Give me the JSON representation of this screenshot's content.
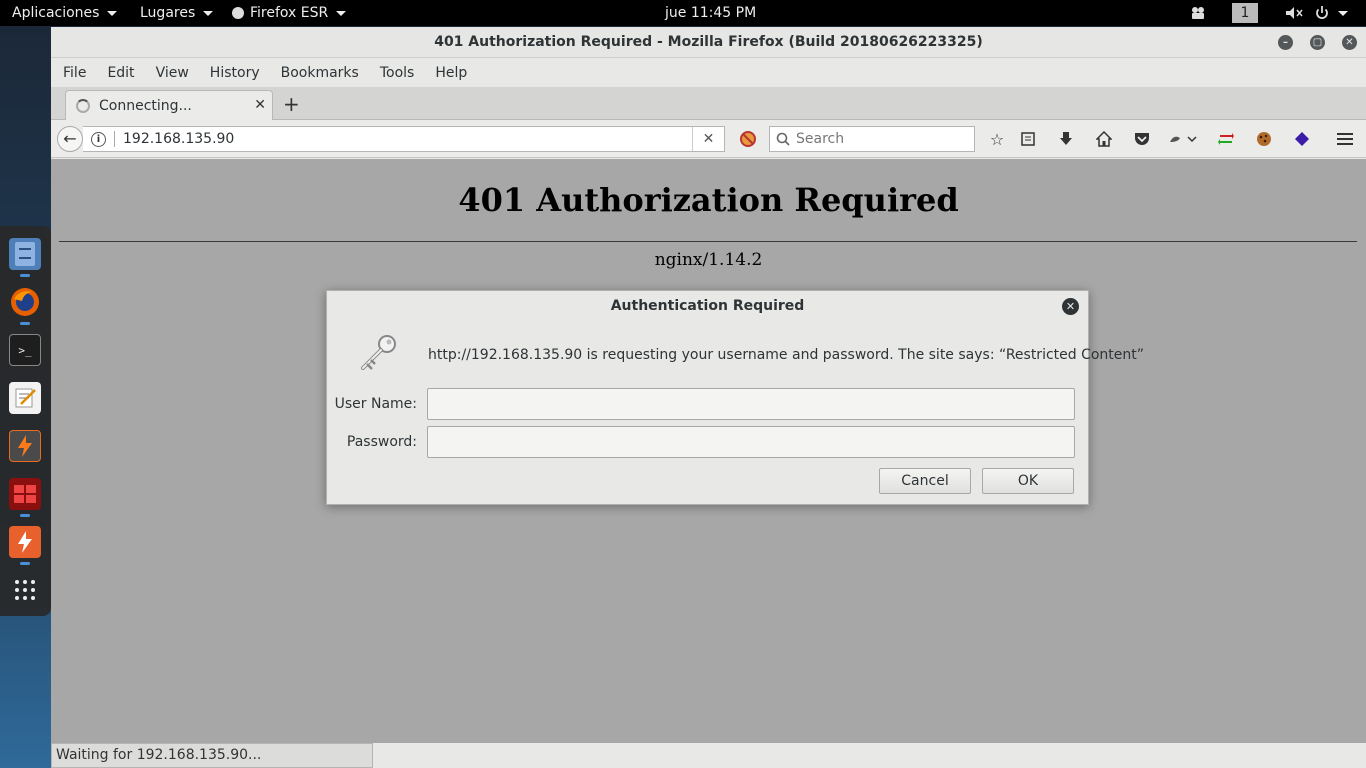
{
  "topbar": {
    "applications": "Aplicaciones",
    "places": "Lugares",
    "active_app": "Firefox ESR",
    "clock": "jue 11:45 PM",
    "workspace": "1"
  },
  "window": {
    "title": "401 Authorization Required - Mozilla Firefox (Build 20180626223325)"
  },
  "menubar": {
    "items": [
      "File",
      "Edit",
      "View",
      "History",
      "Bookmarks",
      "Tools",
      "Help"
    ]
  },
  "tabs": [
    {
      "label": "Connecting..."
    }
  ],
  "navbar": {
    "url": "192.168.135.90",
    "search_placeholder": "Search"
  },
  "page": {
    "heading": "401 Authorization Required",
    "server": "nginx/1.14.2"
  },
  "status": {
    "text": "Waiting for 192.168.135.90..."
  },
  "dialog": {
    "title": "Authentication Required",
    "message": "http://192.168.135.90 is requesting your username and password. The site says: “Restricted Content”",
    "username_label": "User Name:",
    "username_value": "",
    "password_label": "Password:",
    "password_value": "",
    "cancel_label": "Cancel",
    "ok_label": "OK"
  },
  "colors": {
    "page_bg": "#a7a7a7",
    "chrome_bg": "#e8e8e7",
    "topbar_bg": "#000000"
  }
}
